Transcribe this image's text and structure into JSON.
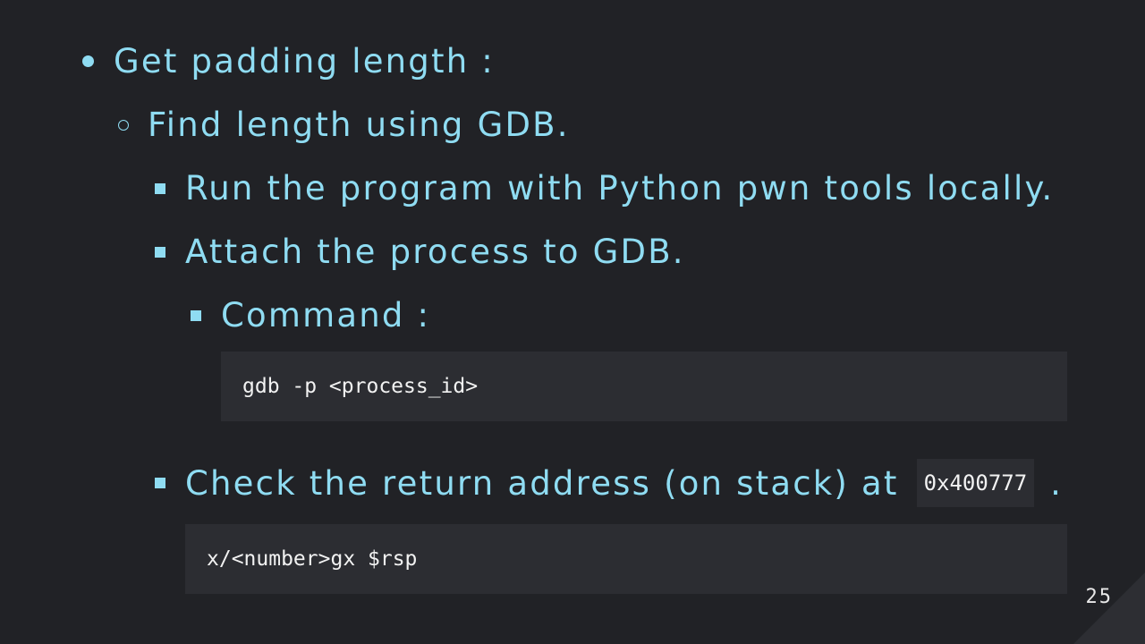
{
  "slide": {
    "items": [
      {
        "text": "Get padding length :"
      },
      {
        "text": "Find length using GDB."
      },
      {
        "text": "Run the program with Python pwn tools locally."
      },
      {
        "text": "Attach the process to GDB."
      },
      {
        "text": "Command :"
      },
      {
        "text_before": "Check the return address (on stack) at",
        "code": "0x400777",
        "text_after": "."
      }
    ],
    "code_blocks": [
      {
        "code": "gdb -p <process_id>"
      },
      {
        "code": "x/<number>gx $rsp"
      }
    ],
    "page_number": "25"
  },
  "colors": {
    "background": "#212226",
    "text": "#8fdcf2",
    "code_background": "#2c2d32",
    "code_text": "#f2f2f2"
  }
}
